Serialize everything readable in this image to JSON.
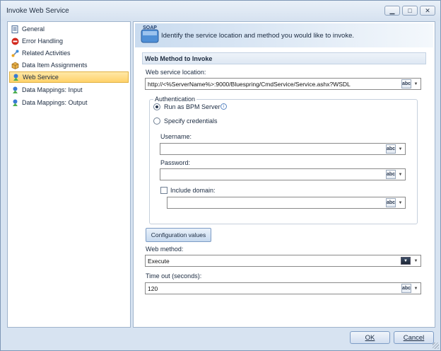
{
  "window": {
    "title": "Invoke Web Service",
    "min_glyph": "▁",
    "max_glyph": "□",
    "close_glyph": "✕"
  },
  "sidebar": {
    "items": [
      {
        "label": "General",
        "icon": "document-icon",
        "active": false
      },
      {
        "label": "Error Handling",
        "icon": "stop-icon",
        "active": false
      },
      {
        "label": "Related Activities",
        "icon": "link-icon",
        "active": false
      },
      {
        "label": "Data Item Assignments",
        "icon": "box-icon",
        "active": false
      },
      {
        "label": "Web Service",
        "icon": "web-service-icon",
        "active": true
      },
      {
        "label": "Data Mappings: Input",
        "icon": "web-service-icon",
        "active": false
      },
      {
        "label": "Data Mappings: Output",
        "icon": "web-service-icon",
        "active": false
      }
    ]
  },
  "banner": {
    "icon_text": "SOAP",
    "text": "Identify the service location and method you would like to invoke."
  },
  "section": {
    "header": "Web Method to Invoke"
  },
  "location": {
    "label": "Web service location:",
    "value": "http://<%ServerName%>:9000/Bluespring/CmdService/Service.ashx?WSDL"
  },
  "auth": {
    "legend": "Authentication",
    "run_as_label": "Run as BPM Server",
    "run_as_selected": true,
    "specify_label": "Specify credentials",
    "specify_selected": false,
    "username_label": "Username:",
    "username_value": "",
    "password_label": "Password:",
    "password_value": "",
    "include_domain_label": "Include domain:",
    "include_domain_checked": false,
    "domain_value": ""
  },
  "config_button": "Configuration values",
  "method": {
    "label": "Web method:",
    "value": "Execute"
  },
  "timeout": {
    "label": "Time out (seconds):",
    "value": "120"
  },
  "abc_glyph": "abc",
  "footer": {
    "ok": "OK",
    "cancel": "Cancel"
  }
}
